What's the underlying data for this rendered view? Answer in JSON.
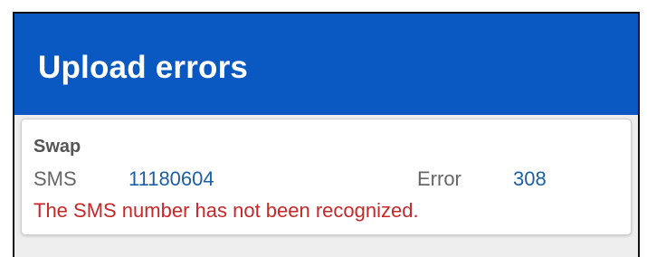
{
  "app_bar": {
    "title": "Upload errors",
    "background_color": "#0a58c2"
  },
  "error_card": {
    "title": "Swap",
    "sms_label": "SMS",
    "sms_number": "11180604",
    "error_label": "Error",
    "error_code": "308",
    "message": "The SMS number has not been recognized.",
    "message_color": "#c62828",
    "value_color": "#1d5fa4"
  }
}
